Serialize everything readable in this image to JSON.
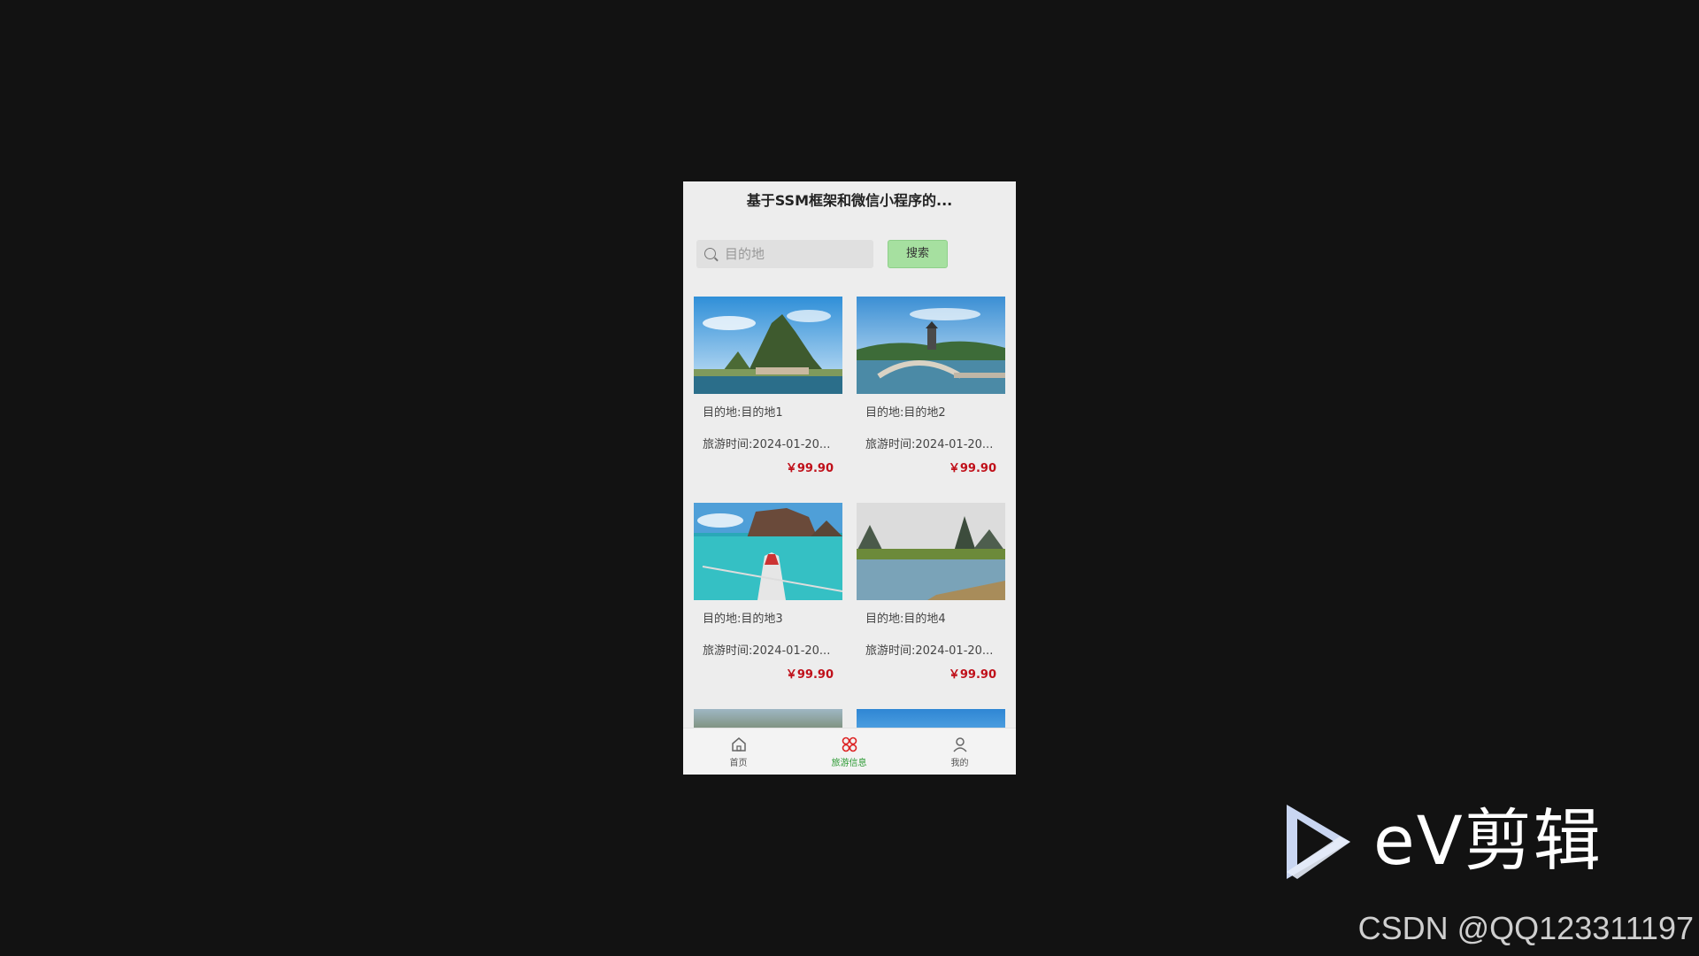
{
  "app": {
    "title": "基于SSM框架和微信小程序的..."
  },
  "search": {
    "placeholder": "目的地",
    "button_label": "搜索"
  },
  "cards": [
    {
      "destination": "目的地:目的地1",
      "time": "旅游时间:2024-01-20...",
      "price": "￥99.90",
      "image": "karst-peak-lake-photo"
    },
    {
      "destination": "目的地:目的地2",
      "time": "旅游时间:2024-01-20...",
      "price": "￥99.90",
      "image": "stone-bridge-pagoda-photo"
    },
    {
      "destination": "目的地:目的地3",
      "time": "旅游时间:2024-01-20...",
      "price": "￥99.90",
      "image": "boat-turquoise-sea-photo"
    },
    {
      "destination": "目的地:目的地4",
      "time": "旅游时间:2024-01-20...",
      "price": "￥99.90",
      "image": "river-karst-bamboo-raft-photo"
    }
  ],
  "tabbar": {
    "items": [
      {
        "label": "首页",
        "icon": "home-icon"
      },
      {
        "label": "旅游信息",
        "icon": "grid-flower-icon",
        "active": true
      },
      {
        "label": "我的",
        "icon": "user-icon"
      }
    ],
    "active_color": "#2e9b35"
  },
  "watermark": {
    "ev_label": "eV剪辑",
    "csdn_label": "CSDN @QQ123311197"
  },
  "colors": {
    "price": "#c0101a",
    "search_button": "#a6e0a0",
    "background": "#121212"
  }
}
